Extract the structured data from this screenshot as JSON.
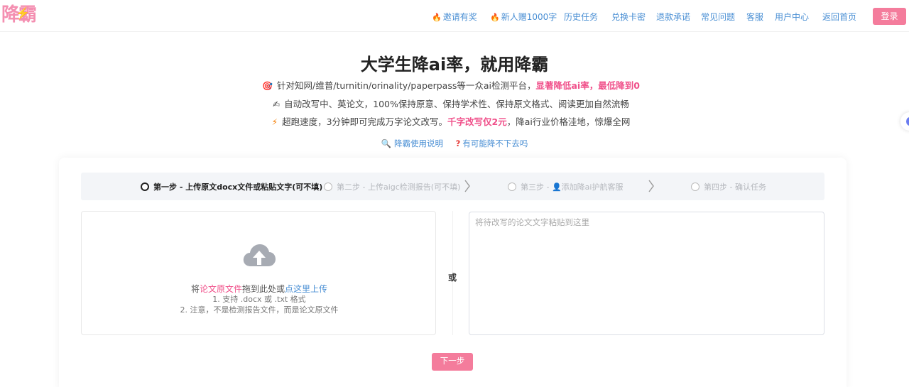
{
  "header": {
    "logo_text": "降霸",
    "nav": [
      {
        "label": "邀请有奖",
        "icon": "fire-icon"
      },
      {
        "label": "新人赠1000字",
        "icon": "fire-icon"
      },
      {
        "label": "历史任务"
      },
      {
        "label": "兑换卡密"
      },
      {
        "label": "退款承诺"
      },
      {
        "label": "常见问题"
      },
      {
        "label": "客服"
      },
      {
        "label": "用户中心"
      },
      {
        "label": "返回首页"
      }
    ],
    "login_label": "登录"
  },
  "hero": {
    "title": "大学生降ai率，就用降霸",
    "features": [
      {
        "icon": "🎯",
        "text": "针对知网/维普/turnitin/orinality/paperpass等一众ai检测平台，",
        "highlight": "显著降低ai率，最低降到0",
        "suffix": ""
      },
      {
        "icon": "✍",
        "text": "自动改写中、英论文，100%保持原意、保持学术性、保持原文格式、阅读更加自然流畅",
        "highlight": "",
        "suffix": ""
      },
      {
        "icon": "⚡",
        "text": "超跑速度，3分钟即可完成万字论文改写。",
        "highlight": "千字改写仅2元",
        "suffix": "，降ai行业价格洼地，惊爆全网"
      }
    ],
    "link_guide": "降霸使用说明",
    "link_faq": "有可能降不下去吗"
  },
  "steps": [
    {
      "label": "第一步 - 上传原文docx文件或粘贴文字(可不填)",
      "active": true
    },
    {
      "label": "第二步 - 上传aigc检测报告(可不填)",
      "active": false
    },
    {
      "label": "第三步 - ",
      "label_suffix": "添加降ai护航客服",
      "active": false
    },
    {
      "label": "第四步 - 确认任务",
      "active": false
    }
  ],
  "upload": {
    "prefix": "将",
    "pink": "论文原文件",
    "middle": "拖到此处或",
    "link": "点这里上传",
    "hint1": "1. 支持 .docx 或 .txt 格式",
    "hint2": "2. 注意，不是检测报告文件，而是论文原文件"
  },
  "or_label": "或",
  "paste_placeholder": "将待改写的论文文字粘贴到这里",
  "next_label": "下一步",
  "colors": {
    "accent": "#f47c9c",
    "link": "#4a8fd4",
    "highlight": "#f0508a"
  }
}
